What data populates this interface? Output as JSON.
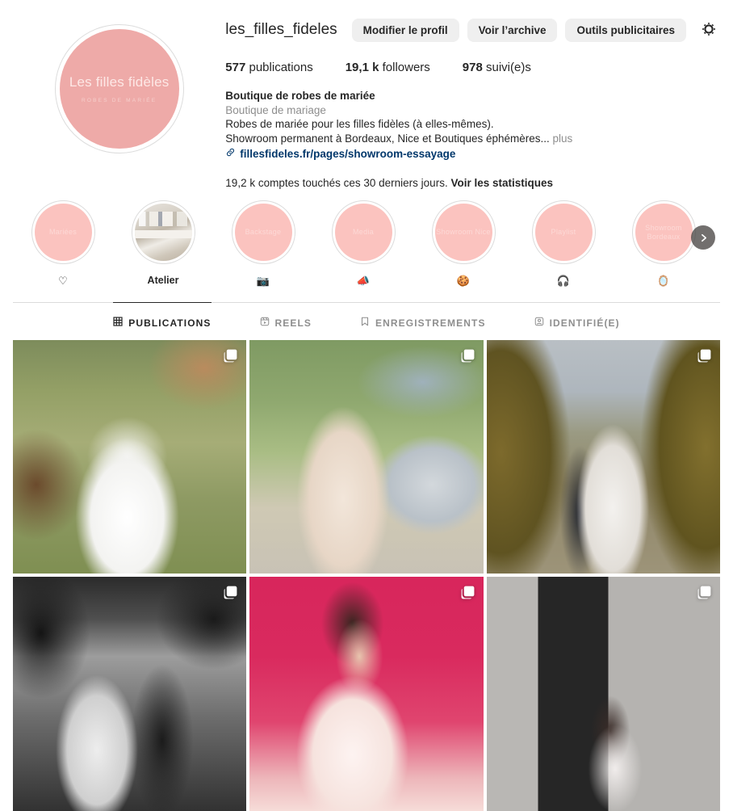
{
  "profile": {
    "username": "les_filles_fideles",
    "avatar": {
      "name_line": "Les filles fidèles",
      "subtitle": "ROBES DE MARIÉE",
      "bg_color": "#eeaaa8"
    },
    "actions": [
      {
        "label": "Modifier le profil",
        "name": "edit-profile-button"
      },
      {
        "label": "Voir l’archive",
        "name": "view-archive-button"
      },
      {
        "label": "Outils publicitaires",
        "name": "ad-tools-button"
      }
    ],
    "settings_icon": "gear-icon",
    "stats": [
      {
        "value": "577",
        "label": "publications"
      },
      {
        "value": "19,1 k",
        "label": "followers"
      },
      {
        "value": "978",
        "label": "suivi(e)s"
      }
    ],
    "bio": {
      "display_name": "Boutique de robes de mariée",
      "category": "Boutique de mariage",
      "line1": "Robes de mariée pour les filles fidèles (à elles-mêmes).",
      "line2": "Showroom permanent à Bordeaux, Nice et Boutiques éphémères...",
      "more_label": "plus",
      "link_icon": "link-icon",
      "link": "fillesfideles.fr/pages/showroom-essayage"
    },
    "insights": {
      "text": "19,2 k comptes touchés ces 30 derniers jours.",
      "link_label": "Voir les statistiques"
    }
  },
  "highlights": {
    "items": [
      {
        "cover_text": "Mariées",
        "label": "♡",
        "type": "color"
      },
      {
        "cover_text": "",
        "label": "Atelier",
        "type": "photo"
      },
      {
        "cover_text": "Backstage",
        "label": "📷",
        "type": "color"
      },
      {
        "cover_text": "Media",
        "label": "📣",
        "type": "color"
      },
      {
        "cover_text": "Showroom Nice",
        "label": "🍪",
        "type": "color"
      },
      {
        "cover_text": "Playlist",
        "label": "🎧",
        "type": "color"
      },
      {
        "cover_text": "Showroom Bordeaux",
        "label": "🪞",
        "type": "color"
      }
    ],
    "next_arrow": "›",
    "cover_color": "#fbc3bf"
  },
  "tabs": [
    {
      "label": "PUBLICATIONS",
      "icon": "grid-icon",
      "active": true
    },
    {
      "label": "REELS",
      "icon": "reels-icon",
      "active": false
    },
    {
      "label": "ENREGISTREMENTS",
      "icon": "bookmark-icon",
      "active": false
    },
    {
      "label": "IDENTIFIÉ(E)",
      "icon": "tagged-icon",
      "active": false
    }
  ],
  "grid": {
    "posts": [
      {
        "description": "Mariée en robe à traîne devant une arche florale en forêt",
        "multi": true
      },
      {
        "description": "Mariée en robe pailletée nude près d’une Porsche cabriolet argentée",
        "multi": true
      },
      {
        "description": "Couple de mariés sur une allée bordée de cyprès",
        "multi": true
      },
      {
        "description": "Photo noir et blanc d’un couple riant sous un arbre",
        "multi": true
      },
      {
        "description": "Mariée en tulle assise sur fond rose vif",
        "multi": true
      },
      {
        "description": "Mariée devant une façade en pierre avec grille en fer",
        "multi": true
      }
    ]
  }
}
